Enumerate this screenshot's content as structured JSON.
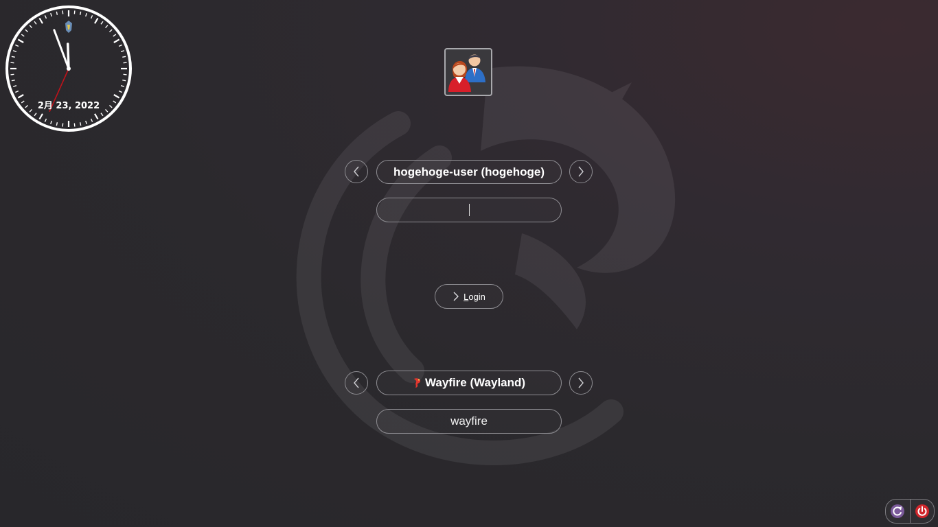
{
  "clock": {
    "date": "2月 23, 2022",
    "time": {
      "hour": 11,
      "minute": 56,
      "second": 34
    }
  },
  "user": {
    "avatar_icon": "users-avatar-icon",
    "name": "hogehoge-user (hogehoge)"
  },
  "password": {
    "value": "",
    "placeholder": ""
  },
  "login": {
    "label_accel": "L",
    "label_rest": "ogin"
  },
  "session": {
    "name": "Wayfire (Wayland)",
    "command": "wayfire",
    "icon": "wayfire-logo-icon"
  },
  "power": {
    "restart_icon": "restart-icon",
    "shutdown_icon": "power-icon",
    "restart_color": "#7b5a9a",
    "shutdown_color": "#d1262b"
  }
}
